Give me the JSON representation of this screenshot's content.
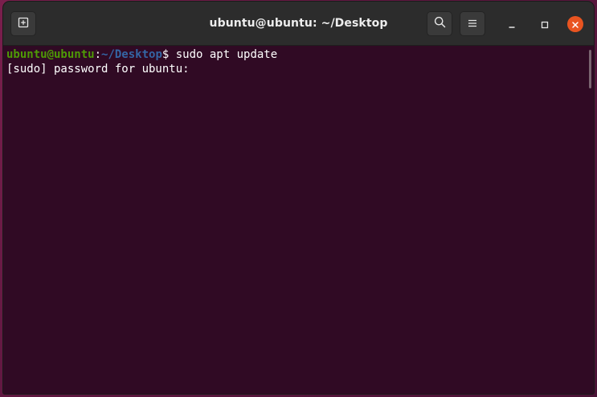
{
  "window": {
    "title": "ubuntu@ubuntu: ~/Desktop"
  },
  "terminal": {
    "prompt_user": "ubuntu@ubuntu",
    "prompt_colon": ":",
    "prompt_path": "~/Desktop",
    "prompt_symbol": "$ ",
    "command": "sudo apt update",
    "output_line": "[sudo] password for ubuntu:"
  },
  "icons": {
    "new_tab": "new-tab-icon",
    "search": "search-icon",
    "menu": "hamburger-menu-icon",
    "minimize": "minimize-icon",
    "maximize": "maximize-icon",
    "close": "close-icon"
  },
  "colors": {
    "terminal_bg": "#300a24",
    "user_host": "#4e9a06",
    "path": "#3465a4",
    "close_accent": "#e95420"
  }
}
